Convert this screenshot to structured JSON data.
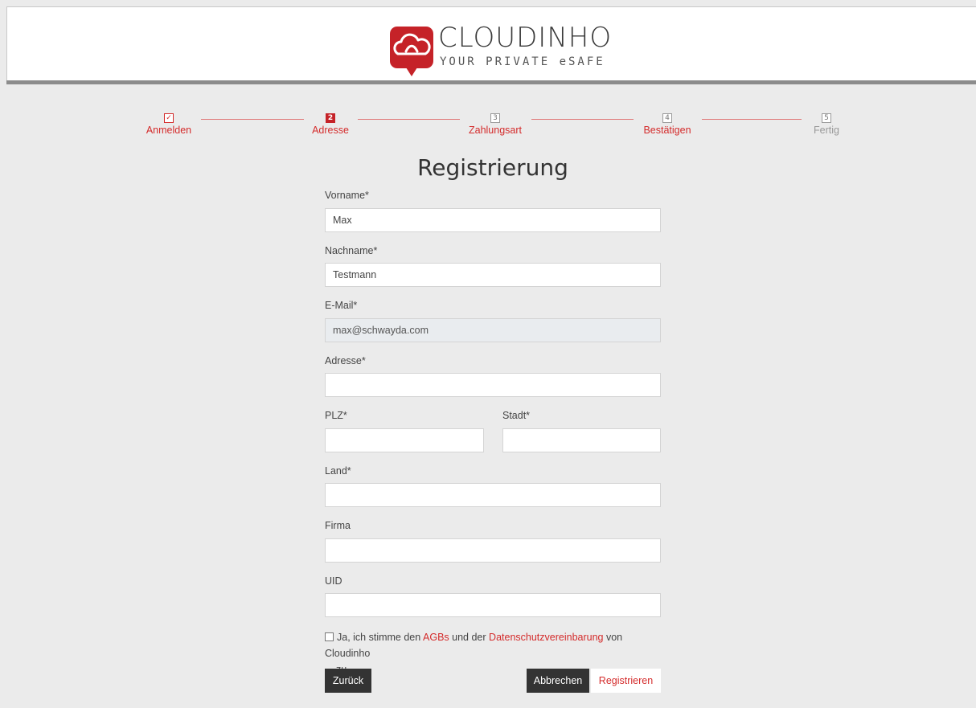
{
  "brand": {
    "name": "CLOUDINHO",
    "tagline": "YOUR PRIVATE eSAFE",
    "accent": "#c52228"
  },
  "stepper": {
    "steps": [
      {
        "num": "✓",
        "label": "Anmelden",
        "state": "done"
      },
      {
        "num": "2",
        "label": "Adresse",
        "state": "active"
      },
      {
        "num": "3",
        "label": "Zahlungsart",
        "state": "pending"
      },
      {
        "num": "4",
        "label": "Bestätigen",
        "state": "pending"
      },
      {
        "num": "5",
        "label": "Fertig",
        "state": "pending"
      }
    ]
  },
  "form": {
    "title": "Registrierung",
    "vorname": {
      "label": "Vorname*",
      "value": "Max"
    },
    "nachname": {
      "label": "Nachname*",
      "value": "Testmann"
    },
    "email": {
      "label": "E-Mail*",
      "value": "max@schwayda.com"
    },
    "adresse": {
      "label": "Adresse*",
      "value": ""
    },
    "plz": {
      "label": "PLZ*",
      "value": ""
    },
    "stadt": {
      "label": "Stadt*",
      "value": ""
    },
    "land": {
      "label": "Land*",
      "value": ""
    },
    "firma": {
      "label": "Firma",
      "value": ""
    },
    "uid": {
      "label": "UID",
      "value": ""
    }
  },
  "consent": {
    "prefix": "Ja, ich stimme den",
    "agb_link": "AGBs",
    "middle": "und der",
    "privacy_link": "Datenschutzvereinbarung",
    "suffix": "von Cloudinho",
    "wrap": "zu",
    "checked": false
  },
  "buttons": {
    "back": "Zurück",
    "cancel": "Abbrechen",
    "register": "Registrieren"
  }
}
